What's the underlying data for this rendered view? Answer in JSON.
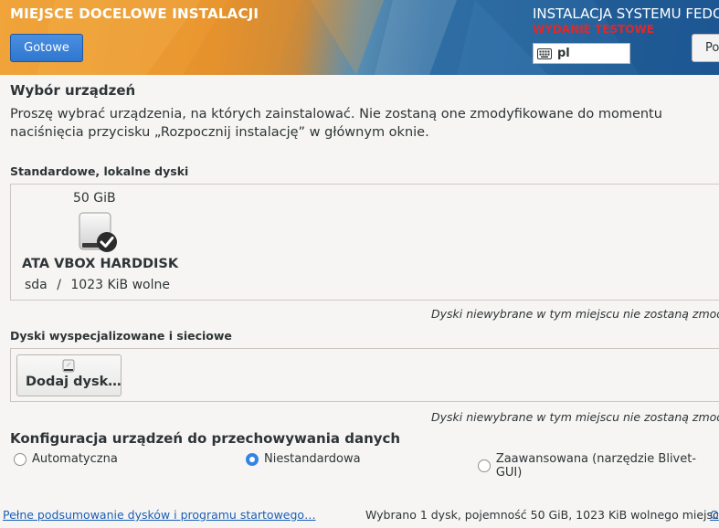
{
  "header": {
    "title": "MIEJSCE DOCELOWE INSTALACJI",
    "done_label": "Gotowe",
    "product_title": "INSTALACJA SYSTEMU FEDC",
    "testing_label": "WYDANIE TESTOWE",
    "keyboard_layout": "pl",
    "help_label": "Po"
  },
  "device_selection": {
    "title": "Wybór urządzeń",
    "intro": "Proszę wybrać urządzenia, na których zainstalować. Nie zostaną one zmodyfikowane do momentu naciśnięcia przycisku „Rozpocznij instalację” w głównym oknie."
  },
  "local_disks": {
    "label": "Standardowe, lokalne dyski",
    "disks": [
      {
        "size": "50 GiB",
        "name": "ATA VBOX HARDDISK",
        "device": "sda",
        "separator": "/",
        "free": "1023 KiB wolne",
        "selected": true
      }
    ],
    "note": "Dyski niewybrane w tym miejscu nie zostaną zmodyfik"
  },
  "specialized_disks": {
    "label": "Dyski wyspecjalizowane i sieciowe",
    "add_label": "Dodaj dysk…",
    "note": "Dyski niewybrane w tym miejscu nie zostaną zmodyfik"
  },
  "storage_config": {
    "title": "Konfiguracja urządzeń do przechowywania danych",
    "options": [
      {
        "label": "Automatyczna",
        "checked": false
      },
      {
        "label": "Niestandardowa",
        "checked": true
      },
      {
        "label": "Zaawansowana (narzędzie Blivet-GUI)",
        "checked": false
      }
    ]
  },
  "footer": {
    "summary_link": "Pełne podsumowanie dysków i programu startowego…",
    "status": "Wybrano 1 dysk, pojemność 50 GiB, 1023 KiB wolnego miejsca",
    "refresh_link": "O"
  },
  "colors": {
    "accent": "#3584e4",
    "testing_red": "#e0282a",
    "link": "#1a5fb4"
  }
}
